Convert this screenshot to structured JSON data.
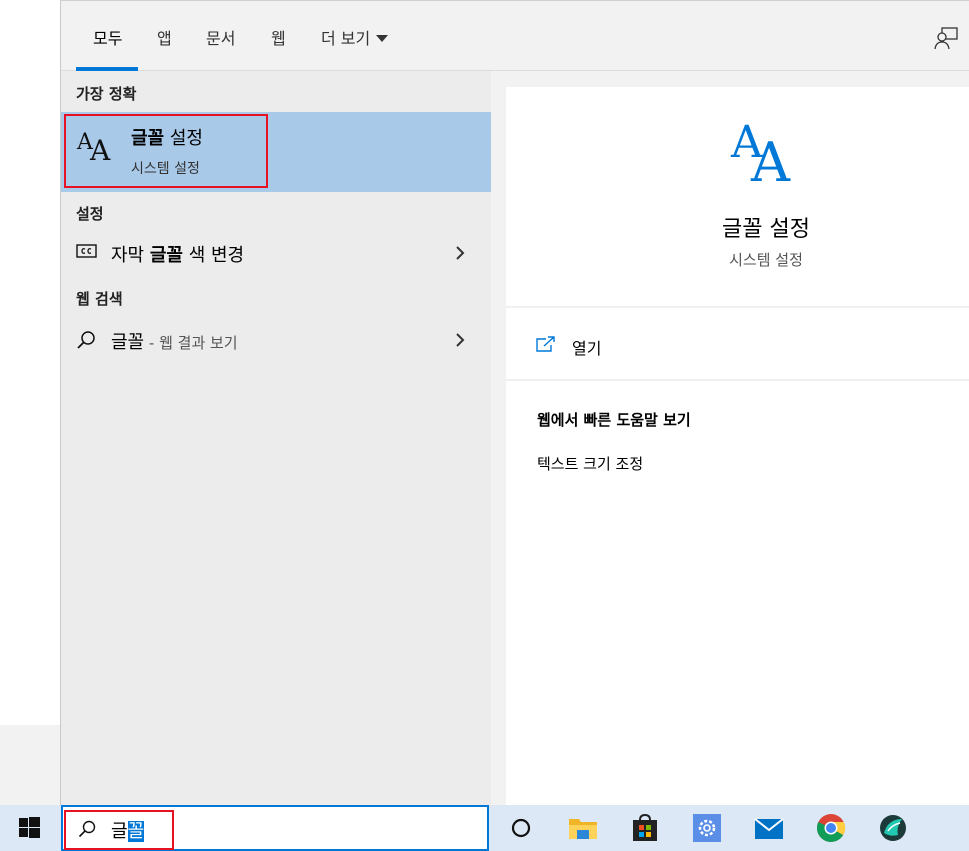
{
  "tabs": [
    {
      "label": "모두"
    },
    {
      "label": "앱"
    },
    {
      "label": "문서"
    },
    {
      "label": "웹"
    },
    {
      "label": "더 보기"
    }
  ],
  "best_match": {
    "heading": "가장 정확",
    "title_bold": "글꼴",
    "title_rest": " 설정",
    "subtitle": "시스템 설정"
  },
  "settings": {
    "heading": "설정",
    "item_prefix": "자막 ",
    "item_bold": "글꼴",
    "item_suffix": " 색 변경"
  },
  "web": {
    "heading": "웹 검색",
    "query": "글꼴",
    "suffix": " - 웹 결과 보기"
  },
  "detail": {
    "title": "글꼴 설정",
    "subtitle": "시스템 설정",
    "open_label": "열기",
    "help_heading": "웹에서 빠른 도움말 보기",
    "help_link": "텍스트 크기 조정"
  },
  "search": {
    "text_plain": "글",
    "text_selected": "꼴"
  },
  "icons": {
    "aa_glyph_1": "A",
    "aa_glyph_2": "A"
  },
  "colors": {
    "accent": "#0078d7",
    "highlight": "#a9c9e9",
    "outline": "#e81123"
  }
}
